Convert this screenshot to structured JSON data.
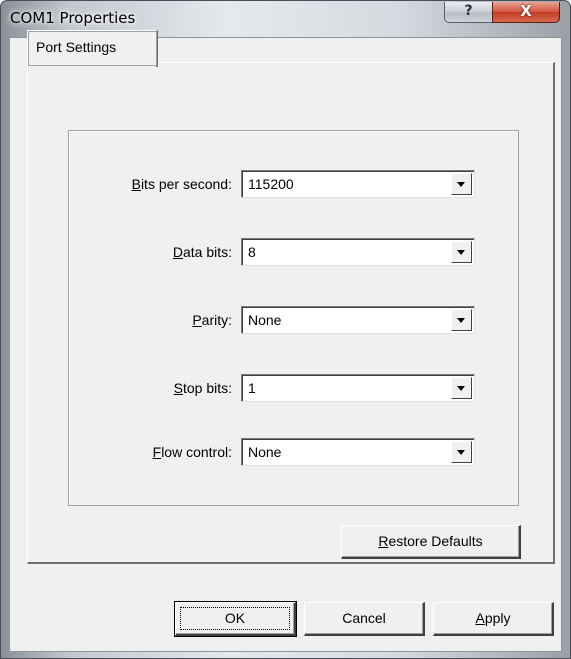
{
  "window": {
    "title": "COM1 Properties",
    "help_label": "?",
    "close_label": "X"
  },
  "tabs": [
    {
      "label": "Port Settings"
    }
  ],
  "fields": [
    {
      "label_access": "B",
      "label_rest": "its per second:",
      "value": "115200"
    },
    {
      "label_access": "D",
      "label_rest": "ata bits:",
      "value": "8"
    },
    {
      "label_access": "P",
      "label_rest": "arity:",
      "value": "None"
    },
    {
      "label_access": "S",
      "label_rest": "top bits:",
      "value": "1"
    },
    {
      "label_access": "F",
      "label_rest": "low control:",
      "value": "None"
    }
  ],
  "restore": {
    "access": "R",
    "rest": "estore Defaults"
  },
  "buttons": {
    "ok": "OK",
    "cancel": "Cancel",
    "apply_access": "A",
    "apply_rest": "pply"
  }
}
